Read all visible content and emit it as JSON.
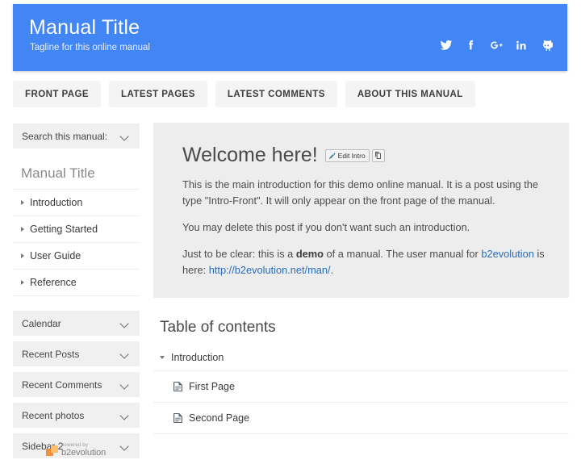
{
  "header": {
    "title": "Manual Title",
    "tagline": "Tagline for this online manual",
    "background_color": "#4285f4",
    "social": [
      {
        "name": "twitter-icon",
        "label": "Twitter"
      },
      {
        "name": "facebook-icon",
        "label": "Facebook"
      },
      {
        "name": "google-plus-icon",
        "label": "Google Plus"
      },
      {
        "name": "linkedin-icon",
        "label": "LinkedIn"
      },
      {
        "name": "github-icon",
        "label": "GitHub"
      }
    ]
  },
  "nav": {
    "tabs": [
      {
        "label": "FRONT PAGE"
      },
      {
        "label": "LATEST PAGES"
      },
      {
        "label": "LATEST COMMENTS"
      },
      {
        "label": "ABOUT THIS MANUAL"
      }
    ]
  },
  "sidebar": {
    "search_panel": {
      "label": "Search this manual:",
      "icon": "chevron-down-icon"
    },
    "widget_title": "Manual Title",
    "chapters": [
      {
        "label": "Introduction"
      },
      {
        "label": "Getting Started"
      },
      {
        "label": "User Guide"
      },
      {
        "label": "Reference"
      }
    ],
    "panels": [
      {
        "label": "Calendar"
      },
      {
        "label": "Recent Posts"
      },
      {
        "label": "Recent Comments"
      },
      {
        "label": "Recent photos"
      },
      {
        "label": "Sidebar 2"
      }
    ],
    "powered_by": {
      "small": "powered by",
      "brand": "b2evolution"
    }
  },
  "main": {
    "intro": {
      "title": "Welcome here!",
      "edit_button": "Edit Intro",
      "duplicate_button_icon": "duplicate-icon",
      "paragraph_1": "This is the main introduction for this demo online manual. It is a post using the type \"Intro-Front\". It will only appear on the front page of the manual.",
      "paragraph_2": "You may delete this post if you don't want such an introduction.",
      "paragraph_3_a": "Just to be clear: this is a ",
      "paragraph_3_bold": "demo",
      "paragraph_3_b": " of a manual. The user manual for ",
      "paragraph_3_link1": "b2evolution",
      "paragraph_3_c": " is here: ",
      "paragraph_3_link2": "http://b2evolution.net/man/",
      "paragraph_3_d": "."
    },
    "toc": {
      "title": "Table of contents",
      "chapters": [
        {
          "label": "Introduction",
          "expanded": true,
          "pages": [
            {
              "label": "First Page",
              "icon": "document-icon"
            },
            {
              "label": "Second Page",
              "icon": "document-icon"
            }
          ]
        }
      ]
    }
  },
  "colors": {
    "accent": "#4285f4",
    "panel_gray": "#f0f0f0",
    "intro_gray": "#ededed",
    "link": "#2b6bb5"
  }
}
